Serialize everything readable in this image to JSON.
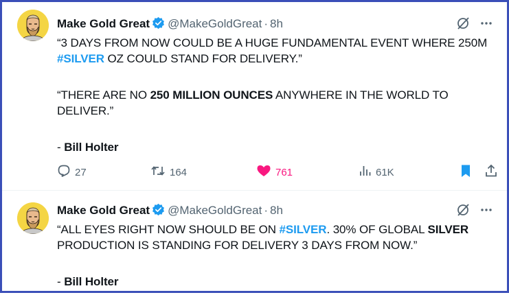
{
  "tweets": [
    {
      "author_name": "Make Gold Great",
      "handle": "@MakeGoldGreat",
      "separator": "·",
      "time": "8h",
      "text": {
        "p1_a": "“3 DAYS FROM NOW COULD BE A HUGE FUNDAMENTAL EVENT WHERE 250M ",
        "p1_hashtag": "#SILVER",
        "p1_b": " OZ COULD STAND FOR DELIVERY.”",
        "p2_a": "“THERE ARE NO ",
        "p2_bold": "250 MILLION OUNCES",
        "p2_b": " ANYWHERE IN THE WORLD TO DELIVER.”",
        "p3_a": "- ",
        "p3_bold": "Bill Holter"
      },
      "metrics": {
        "replies": "27",
        "reposts": "164",
        "likes": "761",
        "views": "61K"
      },
      "liked": true,
      "bookmarked": true
    },
    {
      "author_name": "Make Gold Great",
      "handle": "@MakeGoldGreat",
      "separator": "·",
      "time": "8h",
      "text": {
        "p1_a": "“ALL EYES RIGHT NOW SHOULD BE ON ",
        "p1_hashtag": "#SILVER",
        "p1_b": ". 30% OF GLOBAL ",
        "p1_bold": "SILVER",
        "p1_c": " PRODUCTION IS STANDING FOR DELIVERY 3 DAYS FROM NOW.”",
        "p3_a": "- ",
        "p3_bold": "Bill Holter"
      }
    }
  ],
  "icons": {
    "verified": "verified-badge-icon",
    "grok": "grok-icon",
    "more": "more-icon",
    "reply": "reply-icon",
    "repost": "repost-icon",
    "like": "heart-icon",
    "views": "views-icon",
    "bookmark": "bookmark-icon",
    "share": "share-icon"
  },
  "colors": {
    "accent_blue": "#1d9bf0",
    "like_pink": "#f91880",
    "muted_gray": "#536471",
    "frame_border": "#3b4fb8",
    "avatar_bg": "#f4d544"
  }
}
